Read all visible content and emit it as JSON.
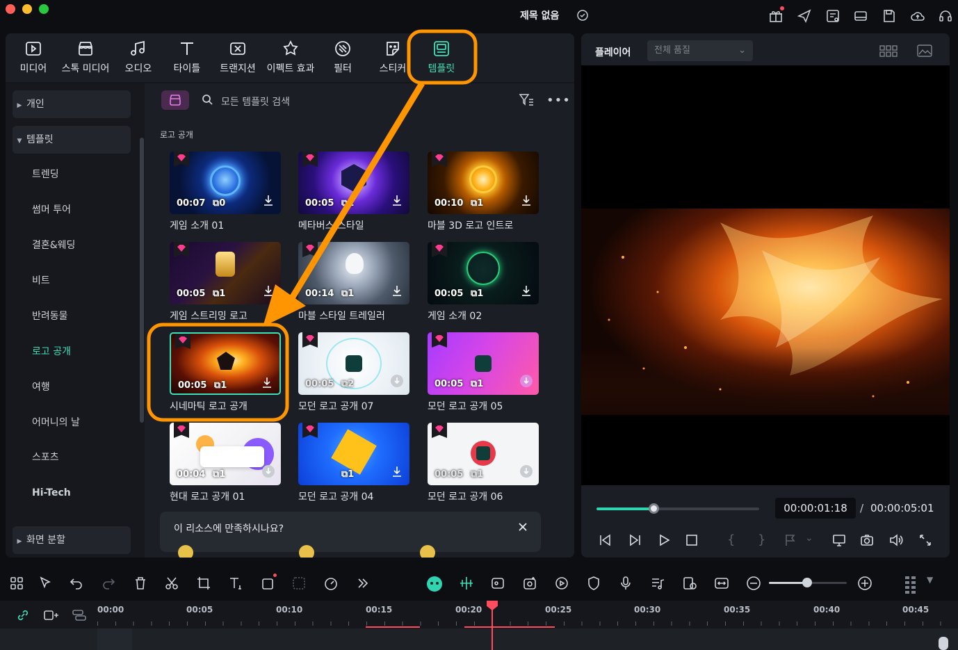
{
  "window": {
    "title": "제목 없음"
  },
  "tabs": [
    {
      "label": "미디어",
      "icon": "media-icon"
    },
    {
      "label": "스톡 미디어",
      "icon": "stock-media-icon"
    },
    {
      "label": "오디오",
      "icon": "audio-icon"
    },
    {
      "label": "타이틀",
      "icon": "title-icon"
    },
    {
      "label": "트랜지션",
      "icon": "transition-icon"
    },
    {
      "label": "이펙트 효과",
      "icon": "effects-icon"
    },
    {
      "label": "필터",
      "icon": "filter-icon"
    },
    {
      "label": "스티커",
      "icon": "sticker-icon"
    },
    {
      "label": "템플릿",
      "icon": "template-icon",
      "active": true
    }
  ],
  "sidebar": {
    "items": [
      {
        "label": "개인",
        "type": "group-collapsed"
      },
      {
        "label": "템플릿",
        "type": "group-expanded"
      },
      {
        "label": "트렌딩"
      },
      {
        "label": "썸머 투어"
      },
      {
        "label": "결혼&웨딩"
      },
      {
        "label": "비트"
      },
      {
        "label": "반려동물"
      },
      {
        "label": "로고 공개",
        "active": true
      },
      {
        "label": "여행"
      },
      {
        "label": "어머니의 날"
      },
      {
        "label": "스포츠"
      },
      {
        "label": "Hi-Tech"
      },
      {
        "label": "화면 분할",
        "type": "group-collapsed"
      }
    ]
  },
  "search": {
    "placeholder": "모든 템플릿 검색"
  },
  "section": {
    "label": "로고 공개"
  },
  "templates": [
    {
      "title": "게임 소개 01",
      "duration": "00:07",
      "count": "0"
    },
    {
      "title": "메타버스 스타일",
      "duration": "00:05",
      "count": "1"
    },
    {
      "title": "마블 3D 로고 인트로",
      "duration": "00:10",
      "count": "1"
    },
    {
      "title": "게임 스트리밍 로고",
      "duration": "00:05",
      "count": "1"
    },
    {
      "title": "마블 스타일 트레일러",
      "duration": "00:14",
      "count": "1"
    },
    {
      "title": "게임 소개 02",
      "duration": "00:05",
      "count": "1"
    },
    {
      "title": "시네마틱 로고 공개",
      "duration": "00:05",
      "count": "1",
      "selected": true
    },
    {
      "title": "모던 로고 공개 07",
      "duration": "00:05",
      "count": "2"
    },
    {
      "title": "모던 로고 공개 05",
      "duration": "00:05",
      "count": "1"
    },
    {
      "title": "현대 로고 공개 01",
      "duration": "00:04",
      "count": "1"
    },
    {
      "title": "모던 로고 공개 04",
      "duration": "",
      "count": "1"
    },
    {
      "title": "모던 로고 공개 06",
      "duration": "00:05",
      "count": "1"
    }
  ],
  "feedback": {
    "question": "이 리소스에 만족하시나요?"
  },
  "player": {
    "title": "플레이어",
    "quality": "전체 품질",
    "current_time": "00:00:01:18",
    "separator": "/",
    "total_time": "00:00:05:01",
    "progress": 0.35
  },
  "timeline": {
    "ruler": [
      "00:00",
      "00:05",
      "00:10",
      "00:15",
      "00:20",
      "00:25",
      "00:30",
      "00:35",
      "00:40",
      "00:45"
    ]
  },
  "colors": {
    "accent": "#2fd4b0",
    "highlight": "#ff9500",
    "playhead": "#ff4d5e"
  }
}
